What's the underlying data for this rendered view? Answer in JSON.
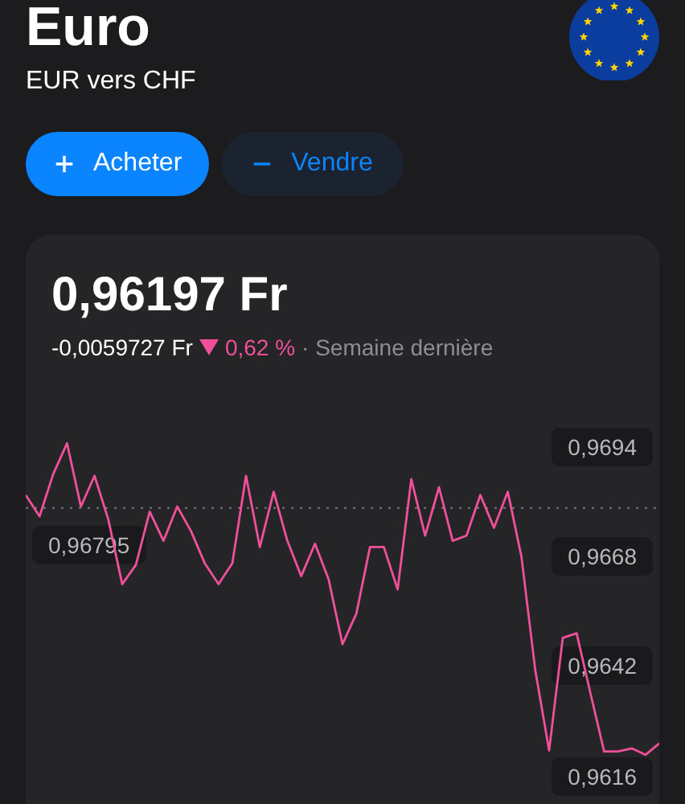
{
  "header": {
    "title": "Euro",
    "subtitle": "EUR vers CHF"
  },
  "actions": [
    {
      "kind": "buy",
      "label": "Acheter"
    },
    {
      "kind": "sell",
      "label": "Vendre"
    }
  ],
  "quote": {
    "price": "0,96197 Fr",
    "change": "-0,0059727 Fr",
    "falling": true,
    "percent": "0,62 %",
    "period": "· Semaine dernière",
    "chart_data": {
      "type": "line",
      "ylim": [
        0.9584,
        0.9744
      ],
      "yticks": [
        {
          "value": 0.9694,
          "label": "0,9694"
        },
        {
          "value": 0.9668,
          "label": "0,9668"
        },
        {
          "value": 0.9642,
          "label": "0,9642"
        },
        {
          "value": 0.9616,
          "label": "0,9616"
        }
      ],
      "ref_lines": [
        {
          "axis": "y",
          "value": 0.96795,
          "label": "0,96795",
          "color": "#777777"
        }
      ],
      "categories": [
        null,
        null,
        null,
        null,
        null,
        null,
        null,
        null,
        null,
        null,
        null,
        null,
        null,
        null,
        null,
        null,
        null,
        null,
        null,
        null,
        null,
        null,
        null,
        null,
        null,
        null,
        null,
        null,
        null,
        null,
        null,
        null,
        null,
        null,
        null,
        null,
        null,
        null,
        null,
        null,
        null,
        null,
        null,
        null,
        null,
        null,
        null
      ],
      "series": [
        {
          "color": "#f0509a",
          "values": [
            0.96825,
            0.96775,
            0.96875,
            0.96948,
            0.96798,
            0.96871,
            0.96767,
            0.96614,
            0.9666,
            0.96786,
            0.96717,
            0.96798,
            0.9674,
            0.96664,
            0.96614,
            0.96664,
            0.96871,
            0.96702,
            0.96833,
            0.96717,
            0.96633,
            0.9671,
            0.96625,
            0.96472,
            0.96544,
            0.96702,
            0.96702,
            0.96602,
            0.96863,
            0.96729,
            0.96844,
            0.96717,
            0.96729,
            0.96825,
            0.96748,
            0.96833,
            0.96679,
            0.9641,
            0.9622,
            0.96487,
            0.96498,
            0.96356,
            0.96218,
            0.96218,
            0.96225,
            0.9621,
            0.96237
          ]
        }
      ]
    }
  }
}
